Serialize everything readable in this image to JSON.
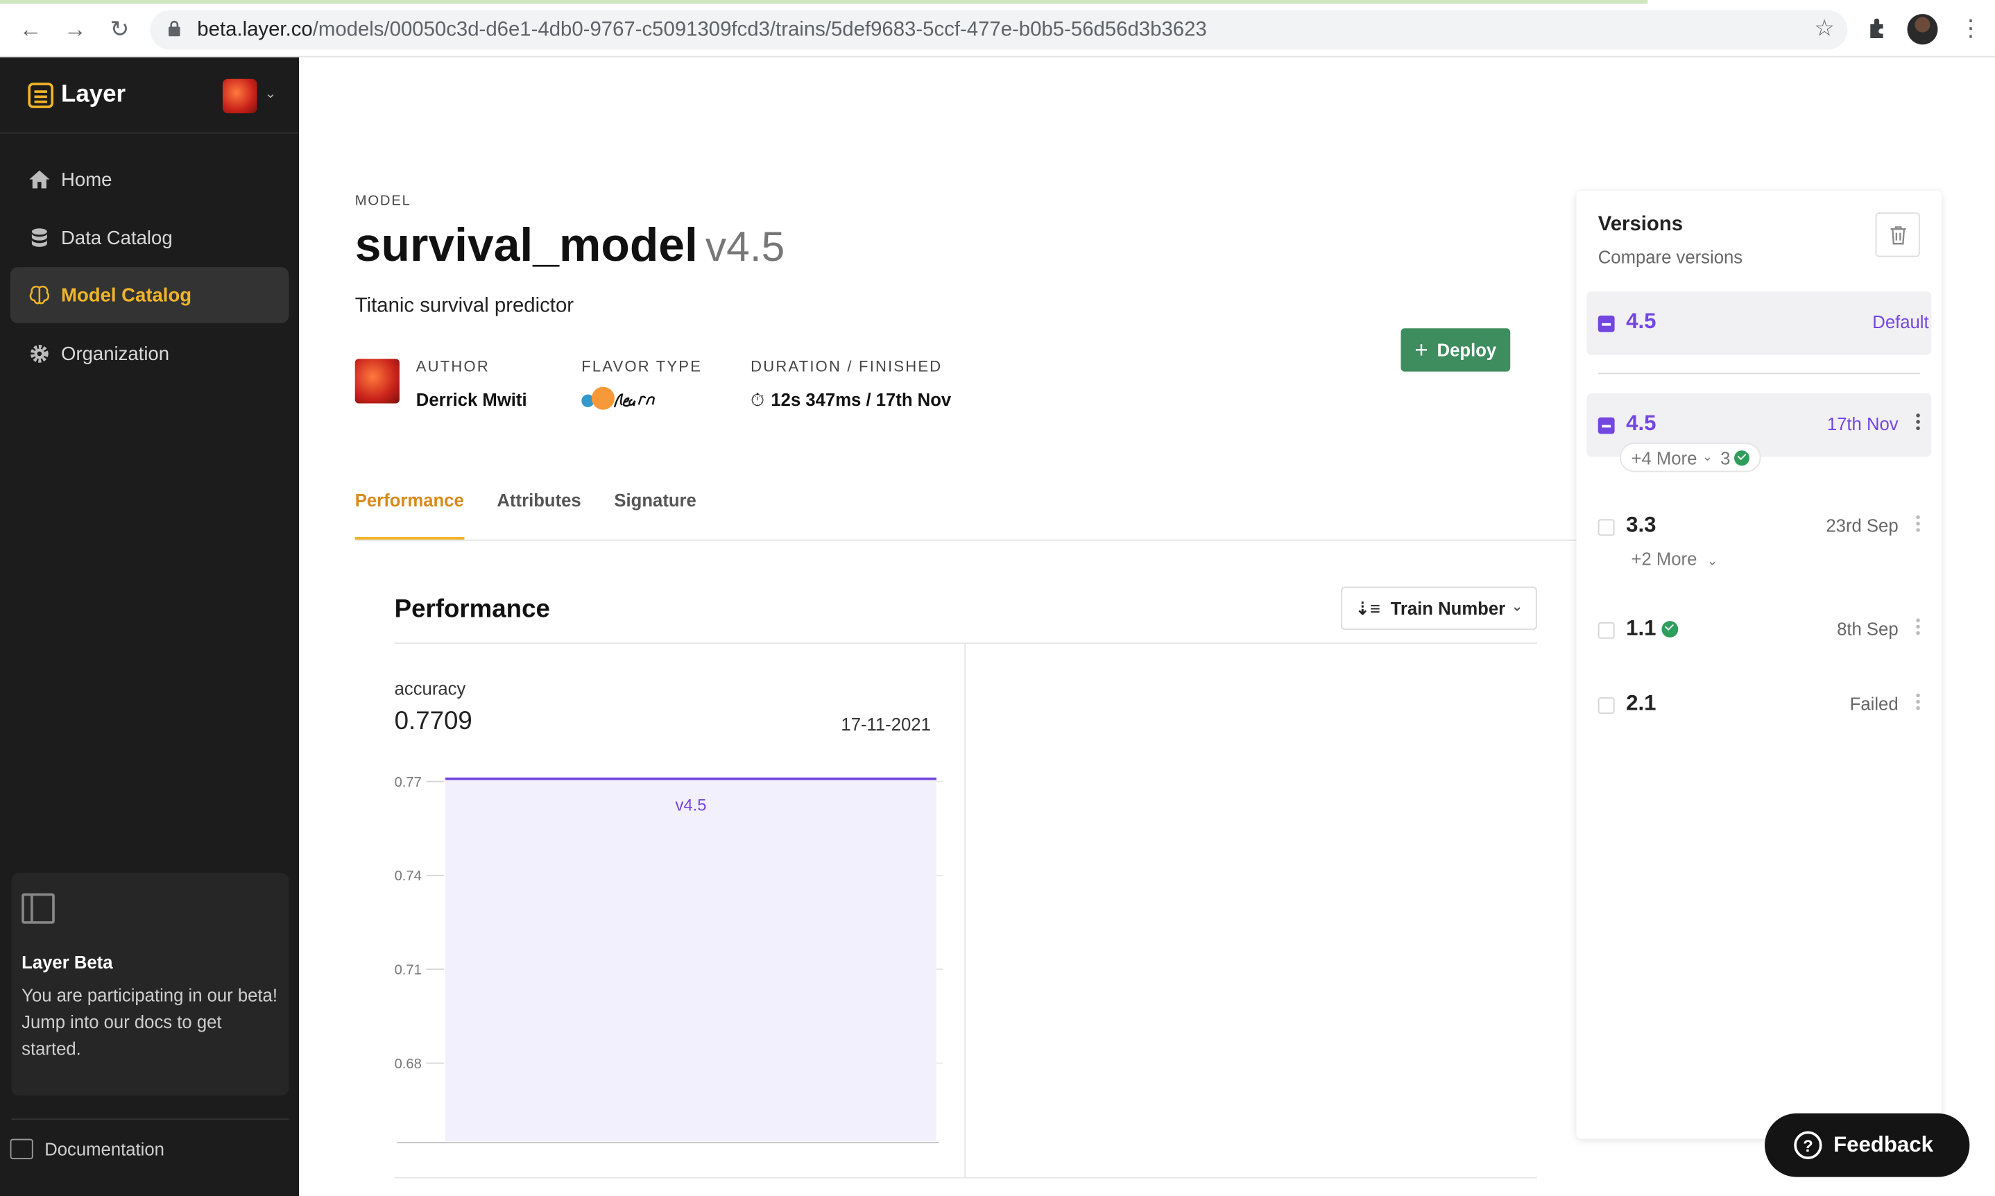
{
  "browser": {
    "url_domain": "beta.layer.co",
    "url_path": "/models/00050c3d-d6e1-4db0-9767-c5091309fcd3/trains/5def9683-5ccf-477e-b0b5-56d56d3b3623"
  },
  "sidebar": {
    "brand": "Layer",
    "items": [
      {
        "label": "Home",
        "icon": "home-icon"
      },
      {
        "label": "Data Catalog",
        "icon": "database-icon"
      },
      {
        "label": "Model Catalog",
        "icon": "brain-icon",
        "active": true
      },
      {
        "label": "Organization",
        "icon": "gear-icon"
      }
    ],
    "beta": {
      "title": "Layer Beta",
      "text": "You are participating in our beta! Jump into our docs to get started."
    },
    "docs_label": "Documentation"
  },
  "model": {
    "eyebrow": "MODEL",
    "name": "survival_model",
    "version": "v4.5",
    "description": "Titanic survival predictor",
    "author_label": "AUTHOR",
    "author": "Derrick Mwiti",
    "flavor_label": "FLAVOR TYPE",
    "flavor_logo": "scikit-learn-logo",
    "duration_label": "DURATION / FINISHED",
    "duration": "12s 347ms / 17th Nov",
    "deploy_label": "Deploy"
  },
  "tabs": [
    "Performance",
    "Attributes",
    "Signature"
  ],
  "performance": {
    "title": "Performance",
    "sort_label": "Train Number",
    "metric_name": "accuracy",
    "metric_value": "0.7709",
    "metric_date": "17-11-2021"
  },
  "chart_data": {
    "type": "area",
    "x": [
      "v4.5"
    ],
    "series": [
      {
        "values": [
          0.7709
        ]
      }
    ],
    "data_label": "v4.5",
    "y_ticks": [
      "0.77",
      "0.74",
      "0.71",
      "0.68"
    ],
    "ylim": [
      0.655,
      0.7709
    ],
    "line_color": "#7446e0",
    "fill_color": "#f3f0fd"
  },
  "versions": {
    "title": "Versions",
    "subtitle": "Compare versions",
    "default_row": {
      "version": "4.5",
      "tag": "Default"
    },
    "rows": [
      {
        "version": "4.5",
        "date": "17th Nov",
        "more": "+4 More",
        "count": "3"
      },
      {
        "version": "3.3",
        "date": "23rd Sep",
        "more": "+2 More"
      },
      {
        "version": "1.1",
        "date": "8th Sep"
      },
      {
        "version": "2.1",
        "date": "Failed"
      }
    ]
  },
  "feedback_label": "Feedback",
  "colors": {
    "accent": "#f0b429",
    "purple": "#7446e0",
    "deploy_green": "#3e8d5e",
    "sidebar_bg": "#1c1c1c"
  }
}
